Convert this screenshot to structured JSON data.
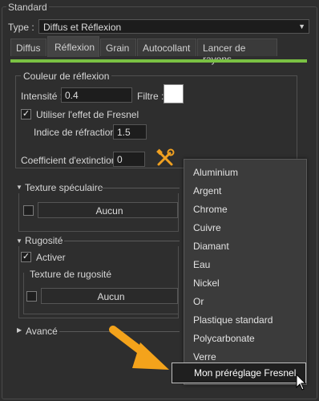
{
  "group": {
    "title": "Standard"
  },
  "type": {
    "label": "Type :",
    "value": "Diffus et Réflexion"
  },
  "tabs": [
    {
      "label": "Diffus"
    },
    {
      "label": "Réflexion"
    },
    {
      "label": "Grain"
    },
    {
      "label": "Autocollant"
    },
    {
      "label": "Lancer de rayons"
    }
  ],
  "active_tab": "Réflexion",
  "accent_color": "#7ac143",
  "reflection_color": {
    "title": "Couleur de réflexion",
    "intensity_label": "Intensité :",
    "intensity_value": "0.4",
    "filter_label": "Filtre :",
    "fresnel_label": "Utiliser l'effet de Fresnel",
    "fresnel_checked": true,
    "refraction_label": "Indice de réfraction :",
    "refraction_value": "1.5",
    "extinction_label": "Coefficient d'extinction :",
    "extinction_value": "0"
  },
  "specular": {
    "title": "Texture spéculaire",
    "texture_value": "Aucun"
  },
  "roughness": {
    "title": "Rugosité",
    "enable_label": "Activer",
    "enable_checked": true,
    "texture_title": "Texture de rugosité",
    "texture_value": "Aucun"
  },
  "advanced": {
    "title": "Avancé"
  },
  "preset_menu": {
    "items": [
      "Aluminium",
      "Argent",
      "Chrome",
      "Cuivre",
      "Diamant",
      "Eau",
      "Nickel",
      "Or",
      "Plastique standard",
      "Polycarbonate",
      "Verre"
    ],
    "highlighted": "Mon préréglage Fresnel"
  }
}
